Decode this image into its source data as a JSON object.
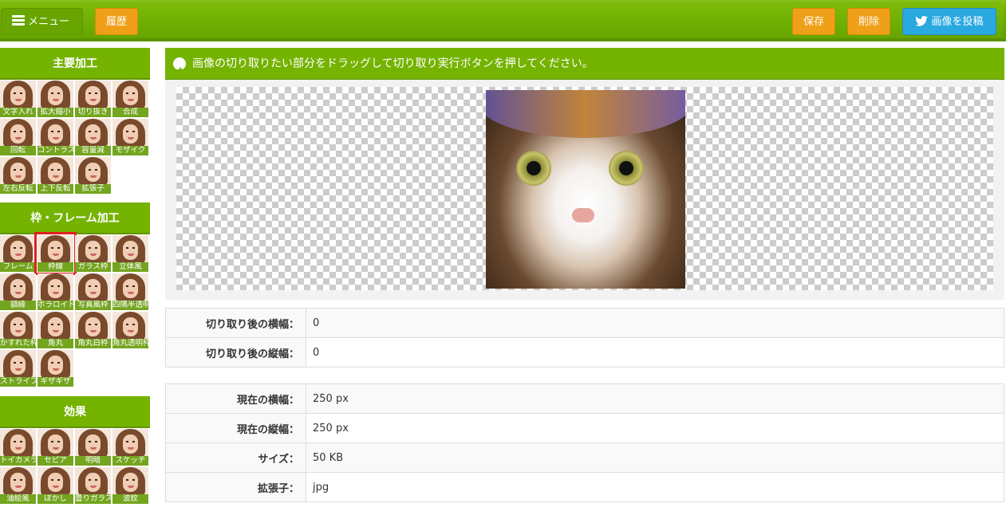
{
  "header": {
    "menu_label": "メニュー",
    "history_label": "履歴",
    "save_label": "保存",
    "delete_label": "削除",
    "tweet_label": "画像を投稿"
  },
  "sidebar": {
    "sections": [
      {
        "title": "主要加工",
        "items": [
          "文字入れ",
          "拡大縮小",
          "切り抜き",
          "合成",
          "回転",
          "コントラスト",
          "容量減",
          "モザイク",
          "左右反転",
          "上下反転",
          "拡張子"
        ]
      },
      {
        "title": "枠・フレーム加工",
        "items": [
          "フレーム",
          "枠線",
          "ガラス枠",
          "立体風",
          "額縁",
          "ポラロイド",
          "写真風枠",
          "四隅半透明",
          "かすれた枠",
          "角丸",
          "角丸白枠",
          "角丸透明枠",
          "ストライプ枠",
          "ギザギザ"
        ]
      },
      {
        "title": "効果",
        "items": [
          "トイカメラ",
          "セピア",
          "明暗",
          "スケッチ",
          "油絵風",
          "ぼかし",
          "曇りガラス",
          "波紋"
        ]
      }
    ],
    "selected_item": "枠線"
  },
  "main": {
    "notice": "画像の切り取りたい部分をドラッグして切り取り実行ボタンを押してください。",
    "crop_info": [
      {
        "label": "切り取り後の横幅：",
        "value": "0"
      },
      {
        "label": "切り取り後の縦幅：",
        "value": "0"
      }
    ],
    "image_info": [
      {
        "label": "現在の横幅：",
        "value": "250 px"
      },
      {
        "label": "現在の縦幅：",
        "value": "250 px"
      },
      {
        "label": "サイズ：",
        "value": "50 KB"
      },
      {
        "label": "拡張子：",
        "value": "jpg"
      }
    ]
  },
  "colors": {
    "brand_green": "#74b300",
    "orange": "#f0a018",
    "twitter_blue": "#2aa8e0",
    "selection_red": "#e02020"
  }
}
